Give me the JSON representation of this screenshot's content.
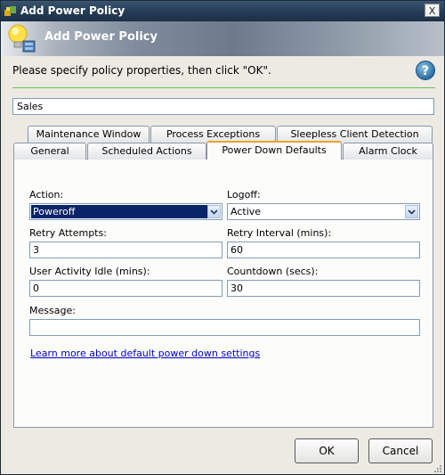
{
  "window": {
    "title": "Add Power Policy",
    "close_label": "X"
  },
  "header": {
    "title": "Add Power Policy"
  },
  "instructions": "Please specify policy properties, then click \"OK\".",
  "help_label": "?",
  "policy_name": "Sales",
  "tabs_back": [
    {
      "label": "Maintenance Window"
    },
    {
      "label": "Process Exceptions"
    },
    {
      "label": "Sleepless Client Detection"
    }
  ],
  "tabs_front": [
    {
      "label": "General"
    },
    {
      "label": "Scheduled Actions"
    },
    {
      "label": "Power Down Defaults",
      "active": true
    },
    {
      "label": "Alarm Clock"
    }
  ],
  "form": {
    "action_label": "Action:",
    "action_value": "Poweroff",
    "logoff_label": "Logoff:",
    "logoff_value": "Active",
    "retry_attempts_label": "Retry Attempts:",
    "retry_attempts_value": "3",
    "retry_interval_label": "Retry Interval (mins):",
    "retry_interval_value": "60",
    "idle_label": "User Activity Idle (mins):",
    "idle_value": "0",
    "countdown_label": "Countdown (secs):",
    "countdown_value": "30",
    "message_label": "Message:",
    "message_value": ""
  },
  "learn_more_link": "Learn more about default power down settings",
  "buttons": {
    "ok": "OK",
    "cancel": "Cancel"
  }
}
